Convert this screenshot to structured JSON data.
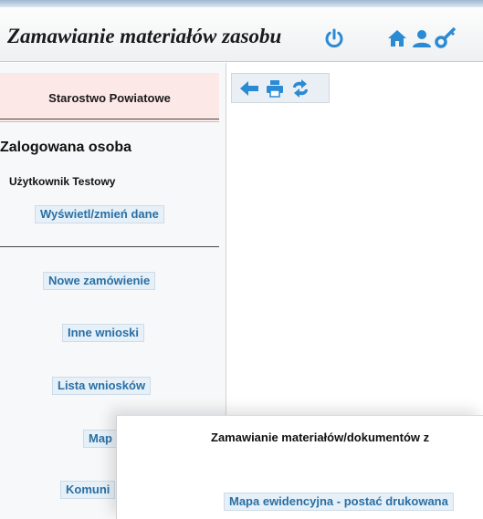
{
  "header": {
    "title": "Zamawianie materiałów zasobu",
    "icons": [
      "power-icon",
      "home-icon",
      "user-icon",
      "key-icon"
    ]
  },
  "sidebar": {
    "organization": "Starostwo Powiatowe",
    "logged_heading": "Zalogowana osoba",
    "user_name": "Użytkownik Testowy",
    "edit_data": "Wyświetl/zmień dane",
    "nav": [
      {
        "label": "Nowe zamówienie"
      },
      {
        "label": "Inne wnioski"
      },
      {
        "label": "Lista wniosków"
      },
      {
        "label": "Map"
      },
      {
        "label": "Komuni"
      }
    ]
  },
  "toolbar": {
    "icons": [
      "back-arrow-icon",
      "print-icon",
      "refresh-icon"
    ]
  },
  "dialog": {
    "title": "Zamawianie materiałów/dokumentów z",
    "option": "Mapa ewidencyjna - postać drukowana"
  },
  "colors": {
    "accent_blue": "#2a8ad4",
    "link_text": "#2a6fa3",
    "org_background": "#fde8e8",
    "button_background": "#e6f0f8"
  }
}
